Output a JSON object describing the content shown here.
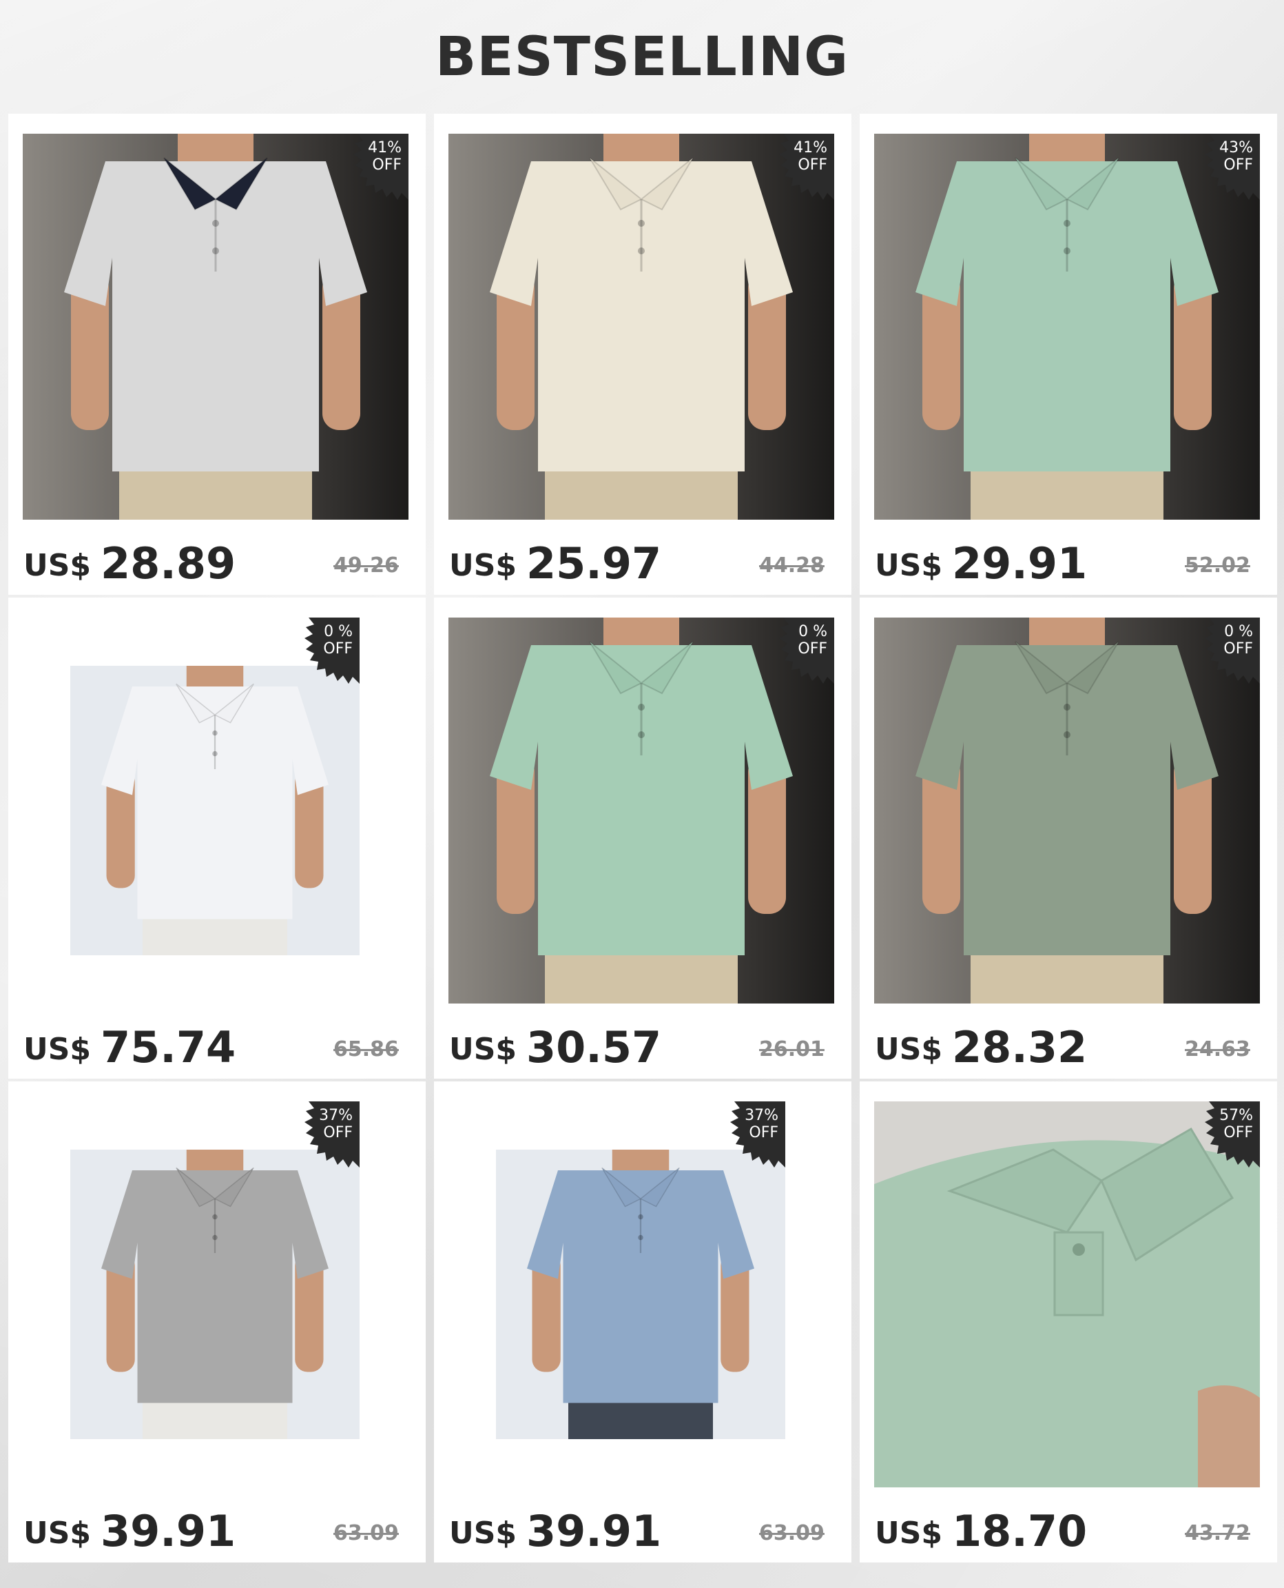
{
  "page": {
    "title": "BESTSELLING"
  },
  "currency_label": "US$",
  "badge_suffix": "OFF",
  "products": [
    {
      "discount": "41%",
      "price": "28.89",
      "original_price": "49.26",
      "shirt_color": "#d9d9d9",
      "collar_color": "#1d2233",
      "background": "dark-studio",
      "style": "polo-contrast-trim"
    },
    {
      "discount": "41%",
      "price": "25.97",
      "original_price": "44.28",
      "shirt_color": "#ece6d6",
      "collar_color": "#e6dfcd",
      "background": "dark-studio",
      "style": "polo-buttoned"
    },
    {
      "discount": "43%",
      "price": "29.91",
      "original_price": "52.02",
      "shirt_color": "#a6cbb6",
      "collar_color": "#9dc4ae",
      "background": "dark-studio",
      "style": "polo-placket"
    },
    {
      "discount": "0 %",
      "price": "75.74",
      "original_price": "65.86",
      "shirt_color": "#f2f3f6",
      "collar_color": "#f0f1f4",
      "background": "light-studio",
      "style": "polo-v-neck"
    },
    {
      "discount": "0 %",
      "price": "30.57",
      "original_price": "26.01",
      "shirt_color": "#a5cdb5",
      "collar_color": "#9cc6ad",
      "background": "dark-studio",
      "style": "polo-v-neck-ribbed"
    },
    {
      "discount": "0 %",
      "price": "28.32",
      "original_price": "24.63",
      "shirt_color": "#8d9e8b",
      "collar_color": "#859683",
      "background": "dark-studio",
      "style": "polo-v-neck"
    },
    {
      "discount": "37%",
      "price": "39.91",
      "original_price": "63.09",
      "shirt_color": "#a9a9a9",
      "collar_color": "#9f9f9f",
      "background": "light-studio",
      "style": "polo-zip"
    },
    {
      "discount": "37%",
      "price": "39.91",
      "original_price": "63.09",
      "shirt_color": "#8fa9c8",
      "collar_color": "#88a2c2",
      "background": "light-studio",
      "style": "polo-striped-trim"
    },
    {
      "discount": "57%",
      "price": "18.70",
      "original_price": "43.72",
      "shirt_color": "#a9c8b3",
      "collar_color": "#9fc0aa",
      "background": "closeup",
      "style": "polo-collar-closeup"
    }
  ]
}
